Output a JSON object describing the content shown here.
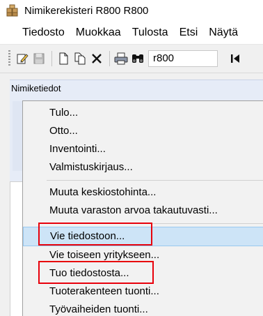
{
  "window": {
    "title": "Nimikerekisteri R800 R800"
  },
  "menubar": {
    "items": [
      "Tiedosto",
      "Muokkaa",
      "Tulosta",
      "Etsi",
      "Näytä"
    ]
  },
  "toolbar": {
    "search_value": "r800",
    "icons": [
      "edit-icon",
      "save-icon",
      "new-document-icon",
      "copy-document-icon",
      "delete-icon",
      "print-icon",
      "binoculars-icon",
      "first-record-icon"
    ]
  },
  "panel": {
    "group_label": "Nimiketiedot"
  },
  "context_menu": {
    "items": [
      {
        "label": "Tulo..."
      },
      {
        "label": "Otto..."
      },
      {
        "label": "Inventointi..."
      },
      {
        "label": "Valmistuskirjaus..."
      },
      {
        "label": "Muuta keskiostohinta..."
      },
      {
        "label": "Muuta varaston arvoa takautuvasti..."
      },
      {
        "label": "Vie tiedostoon...",
        "highlighted": true,
        "hovered": true
      },
      {
        "label": "Vie toiseen yritykseen..."
      },
      {
        "label": "Tuo tiedostosta...",
        "highlighted": true
      },
      {
        "label": "Tuoterakenteen tuonti..."
      },
      {
        "label": "Työvaiheiden tuonti..."
      }
    ]
  },
  "colors": {
    "highlight_border": "#e8000b",
    "hover_background": "#cde4f7",
    "panel_background": "#e6ecf7"
  }
}
